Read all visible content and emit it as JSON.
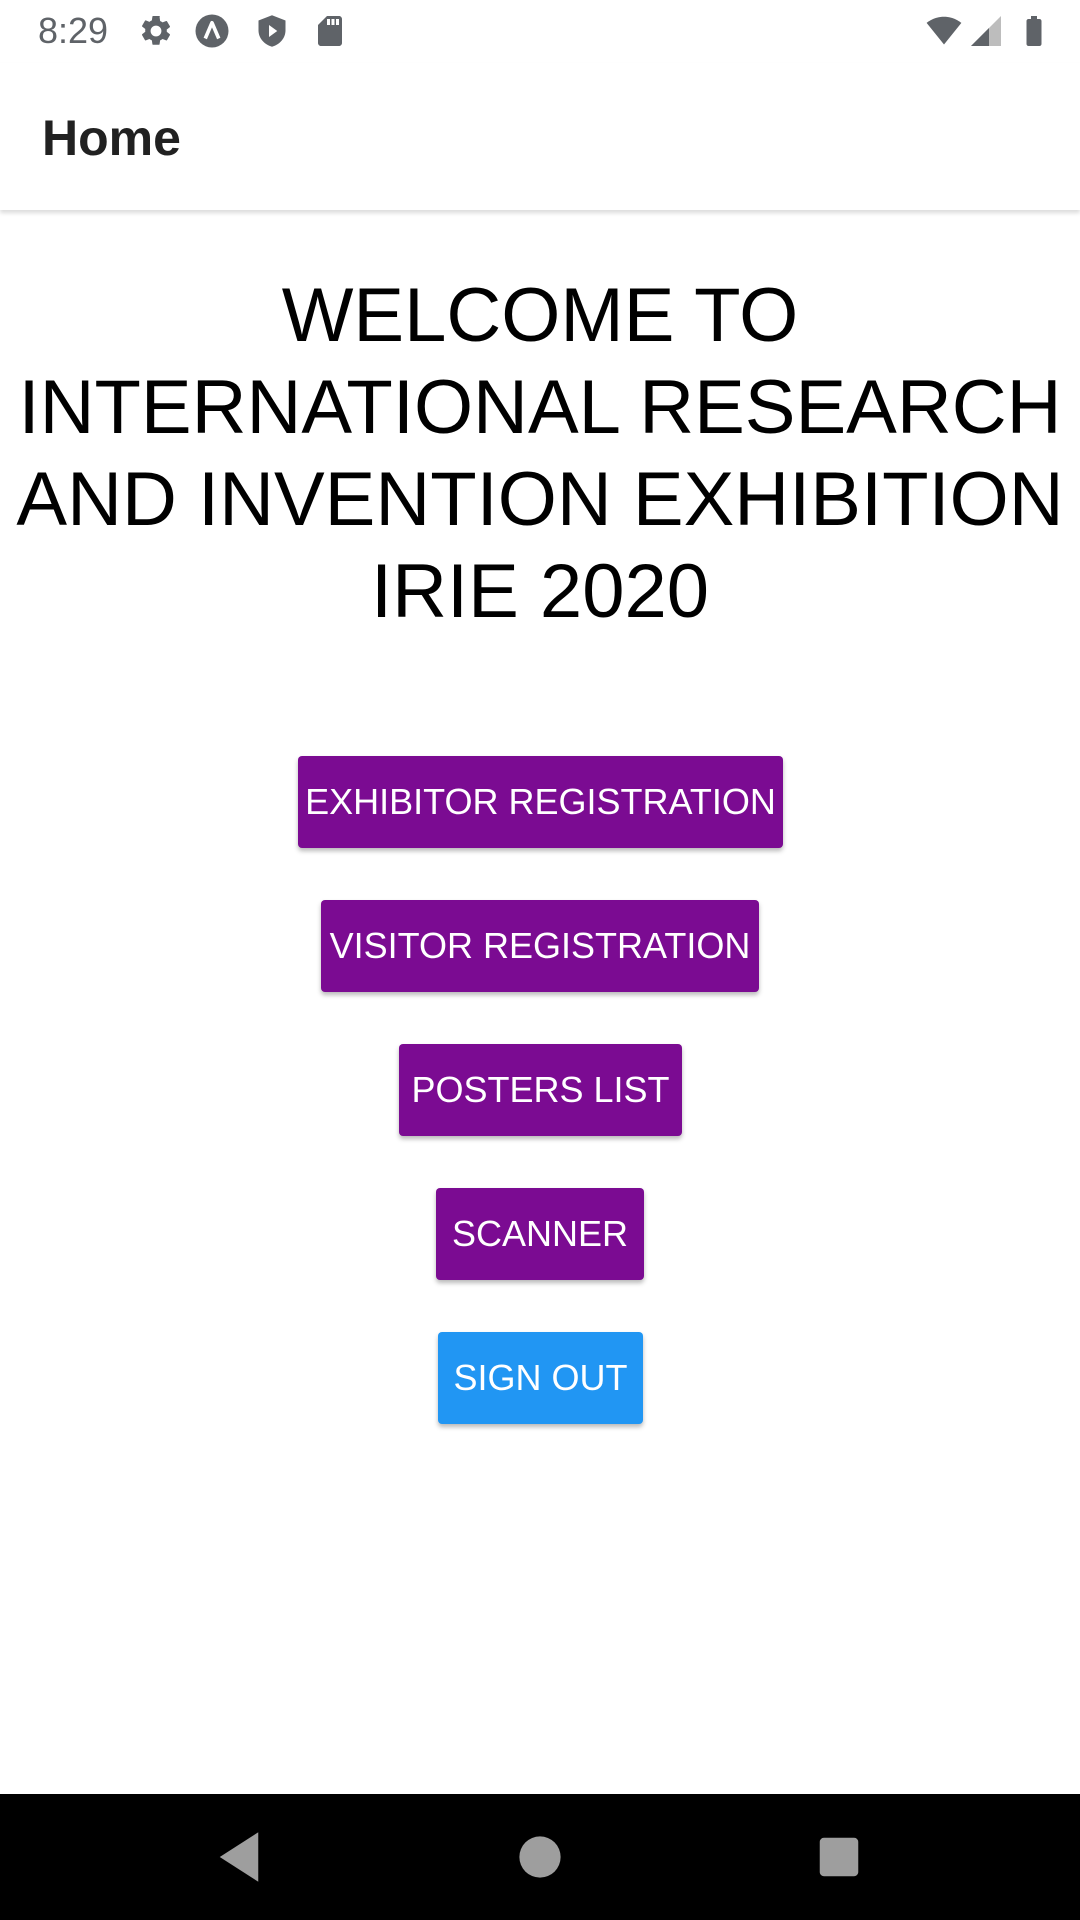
{
  "status_bar": {
    "time": "8:29",
    "left_icons": [
      "settings-icon",
      "launcher-icon",
      "shield-play-icon",
      "sd-card-icon"
    ],
    "right_icons": [
      "wifi-icon",
      "cell-signal-icon",
      "battery-icon"
    ]
  },
  "app_bar": {
    "title": "Home"
  },
  "welcome": {
    "lines": [
      "WELCOME TO",
      "INTERNATIONAL RESEARCH",
      "AND INVENTION EXHIBITION",
      "IRIE 2020"
    ]
  },
  "buttons": {
    "exhibitor_registration": "EXHIBITOR REGISTRATION",
    "visitor_registration": "VISITOR REGISTRATION",
    "posters_list": "POSTERS LIST",
    "scanner": "SCANNER",
    "sign_out": "SIGN OUT"
  },
  "colors": {
    "primary_button": "#7b0b92",
    "sign_out_button": "#2196f3",
    "nav_bar": "#000000"
  },
  "nav_bar": {
    "icons": [
      "back-icon",
      "home-icon",
      "recents-icon"
    ]
  }
}
